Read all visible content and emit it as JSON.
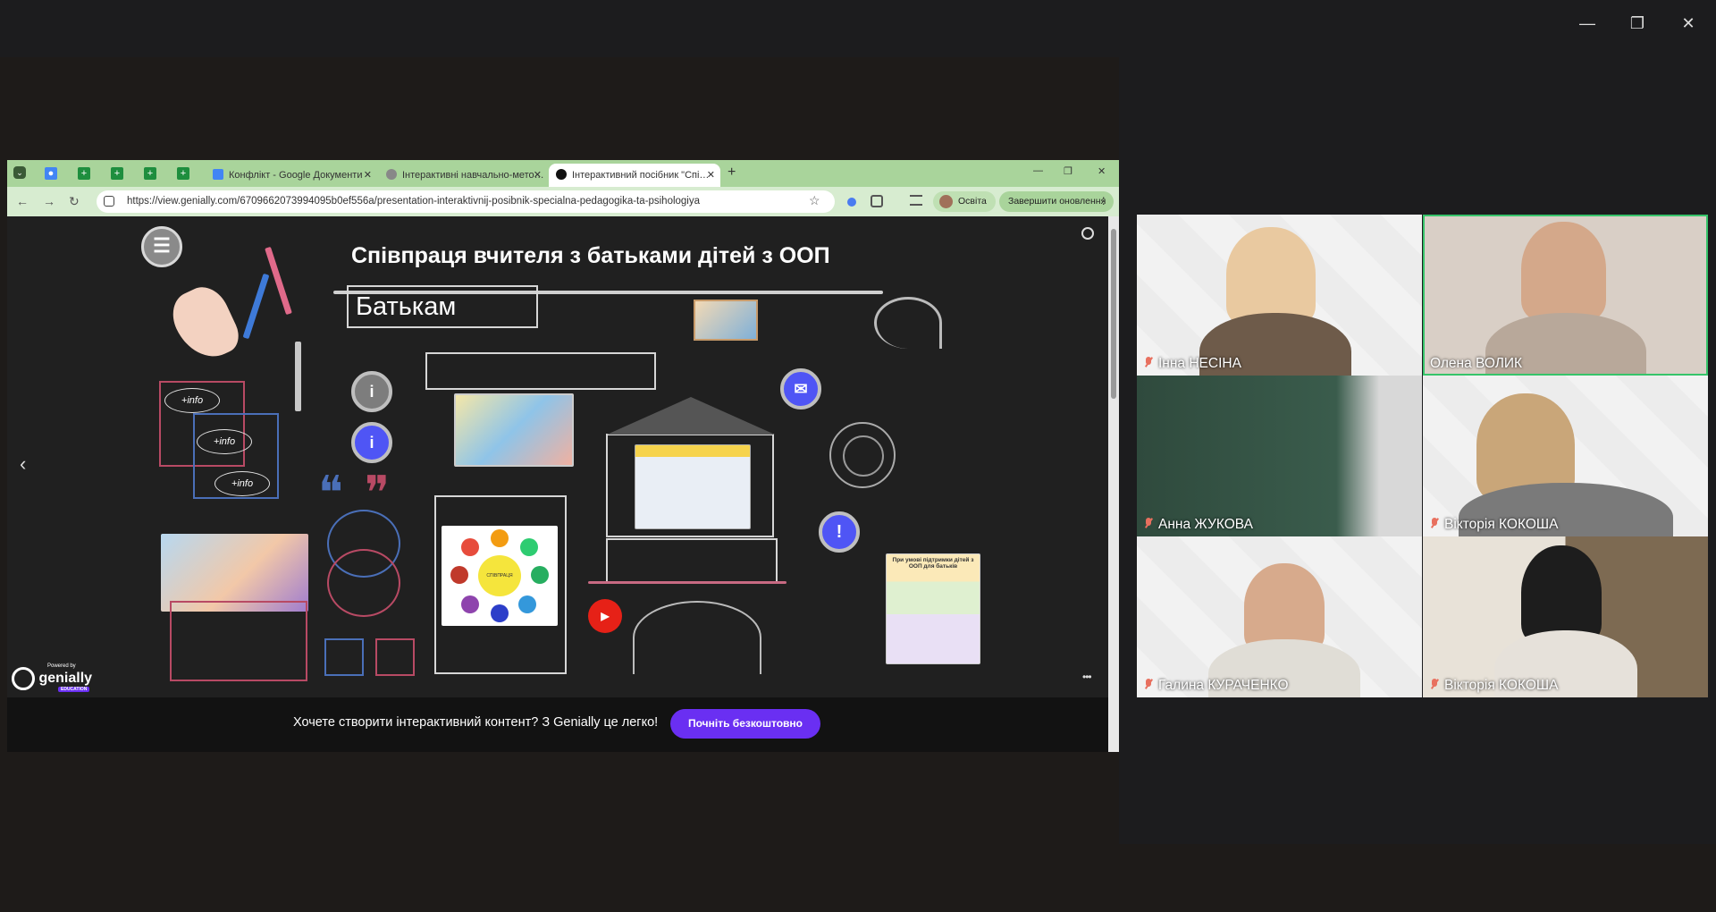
{
  "window": {
    "controls": {
      "minimize": "—",
      "restore": "❐",
      "close": "✕"
    }
  },
  "browser": {
    "tabs": [
      {
        "label": "Конфлікт - Google Документи",
        "favicon_color": "#4285f4"
      },
      {
        "label": "Інтерактивні навчально-мето…",
        "favicon_color": "#888888"
      },
      {
        "label": "Інтерактивний посібник \"Спі…",
        "favicon_color": "#111111",
        "active": true
      }
    ],
    "new_tab": "+",
    "window_controls": {
      "minimize": "—",
      "restore": "❐",
      "close": "✕"
    },
    "url": "https://view.genially.com/6709662073994095b0ef556a/presentation-interaktivnij-posibnik-specialna-pedagogika-ta-psihologiya",
    "profile_label": "Освіта",
    "update_button": "Завершити оновлення",
    "nav": {
      "back": "←",
      "forward": "→",
      "reload": "↻",
      "star": "☆",
      "more": "⋮"
    }
  },
  "slide": {
    "title": "Співпраця вчителя з батьками  дітей з ООП",
    "subtitle": "Батькам",
    "menu_icon": "☰",
    "info_tags": [
      "+info",
      "+info",
      "+info"
    ],
    "info_btn_1": "i",
    "info_btn_2": "i",
    "alert_btn": "!",
    "mail_icon": "✉",
    "quote_icon": "❝",
    "quote_icon_2": "❞",
    "prev_arrow": "‹",
    "more_dots": "•••",
    "center_circle_label": "СПІВПРАЦЯ",
    "poster_title": "При умові підтримки дітей з ООП для батьків"
  },
  "promo": {
    "text": "Хочете створити інтерактивний контент? З Genially це легко!",
    "button": "Почніть безкоштовно",
    "logo": "genially",
    "logo_badge": "EDUCATION",
    "powered": "Powered by"
  },
  "participants": [
    {
      "name": "Інна НЕСІНА",
      "muted": true,
      "active": false
    },
    {
      "name": "Олена ВОЛИК",
      "muted": false,
      "active": true
    },
    {
      "name": "Анна ЖУКОВА",
      "muted": true,
      "active": false
    },
    {
      "name": "Вікторія КОКОША",
      "muted": true,
      "active": false
    },
    {
      "name": "Галина КУРАЧЕНКО",
      "muted": true,
      "active": false
    },
    {
      "name": "Вікторія КОКОША",
      "muted": true,
      "active": false
    }
  ],
  "colors": {
    "tab_bar": "#a9d49b",
    "address_bar": "#d7ecd0",
    "promo_button": "#6a2ff2",
    "active_speaker_border": "#36c46a",
    "info_button": "#4f55f5"
  }
}
